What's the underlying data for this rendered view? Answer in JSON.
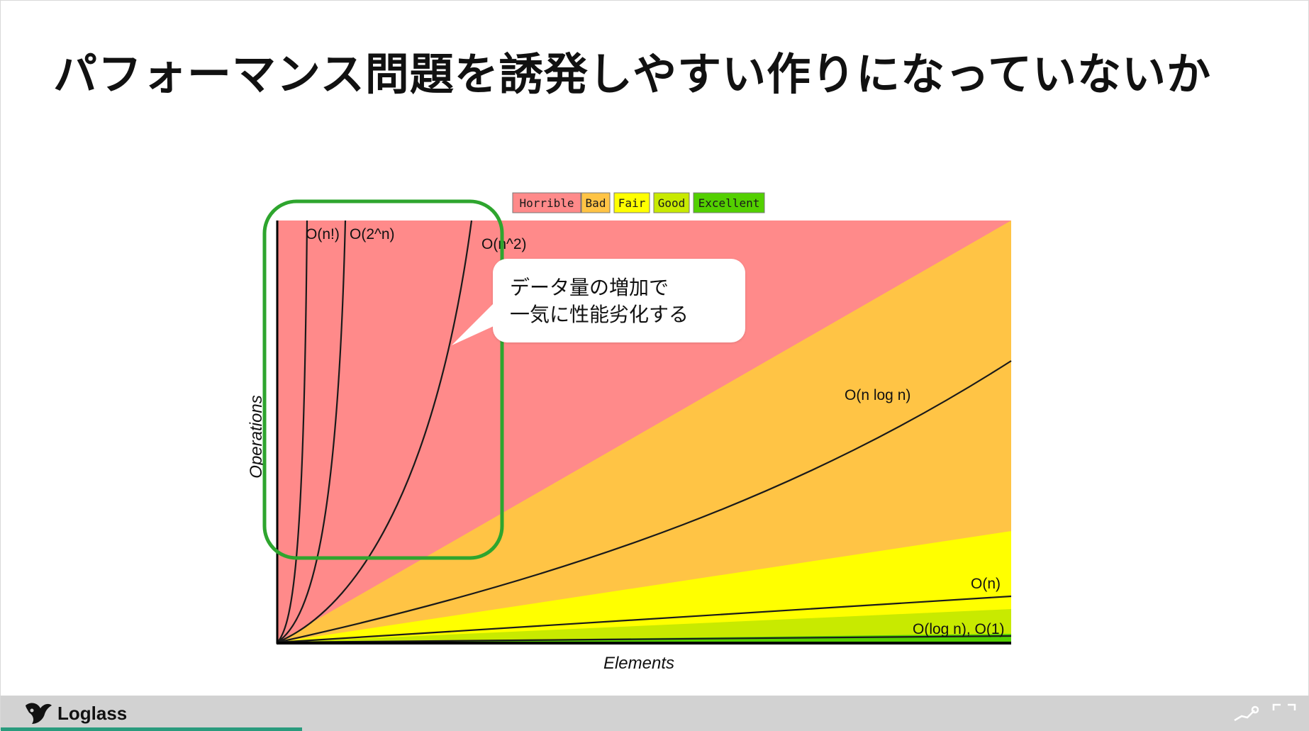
{
  "slide": {
    "title": "パフォーマンス問題を誘発しやすい作りになっていないか"
  },
  "callout": {
    "line1": "データ量の増加で",
    "line2": "一気に性能劣化する"
  },
  "chart_data": {
    "type": "area",
    "xlabel": "Elements",
    "ylabel": "Operations",
    "legend": {
      "position": "top",
      "entries": [
        {
          "label": "Horrible",
          "color": "#ff8a8a"
        },
        {
          "label": "Bad",
          "color": "#ffc445"
        },
        {
          "label": "Fair",
          "color": "#ffff00"
        },
        {
          "label": "Good",
          "color": "#c8ea00"
        },
        {
          "label": "Excellent",
          "color": "#53d000"
        }
      ]
    },
    "regions": [
      {
        "name": "Horrible",
        "color": "#ff8a8a"
      },
      {
        "name": "Bad",
        "color": "#ffc445"
      },
      {
        "name": "Fair",
        "color": "#ffff00"
      },
      {
        "name": "Good",
        "color": "#c8ea00"
      },
      {
        "name": "Excellent",
        "color": "#53d000"
      }
    ],
    "curves": [
      {
        "label": "O(n!)"
      },
      {
        "label": "O(2^n)"
      },
      {
        "label": "O(n^2)"
      },
      {
        "label": "O(n log n)"
      },
      {
        "label": "O(n)"
      },
      {
        "label": "O(log n), O(1)"
      }
    ],
    "highlight": {
      "color": "#2ea52e"
    }
  },
  "footer": {
    "brand": "Loglass",
    "progress": 0.23
  }
}
